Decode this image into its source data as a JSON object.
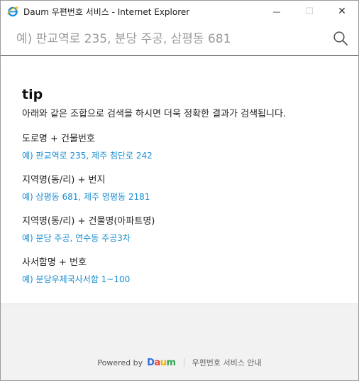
{
  "window": {
    "title": "Daum 우편번호 서비스 - Internet Explorer",
    "minimize_glyph": "—",
    "maximize_glyph": "☐",
    "close_glyph": "✕"
  },
  "search": {
    "placeholder": "예) 판교역로 235, 분당 주공, 삼평동 681",
    "value": "",
    "icon": "search-icon"
  },
  "tip": {
    "title": "tip",
    "description": "아래와 같은 조합으로 검색을 하시면 더욱 정확한 결과가 검색됩니다.",
    "items": [
      {
        "label": "도로명 + 건물번호",
        "example": "예) 판교역로 235,  제주 첨단로 242"
      },
      {
        "label": "지역명(동/리) + 번지",
        "example": "예) 삼평동 681,  제주 영평동 2181"
      },
      {
        "label": "지역명(동/리) + 건물명(아파트명)",
        "example": "예) 분당 주공,  연수동 주공3차"
      },
      {
        "label": "사서함명 + 번호",
        "example": "예) 분당우체국사서함 1~100"
      }
    ]
  },
  "footer": {
    "powered_by": "Powered by",
    "logo_text": "Daum",
    "guide_link": "우편번호 서비스 안내"
  },
  "colors": {
    "example_blue": "#1a8ed1",
    "ie_blue": "#1c8fde",
    "ie_gold": "#f2b90c",
    "footer_bg": "#f2f2f2"
  }
}
